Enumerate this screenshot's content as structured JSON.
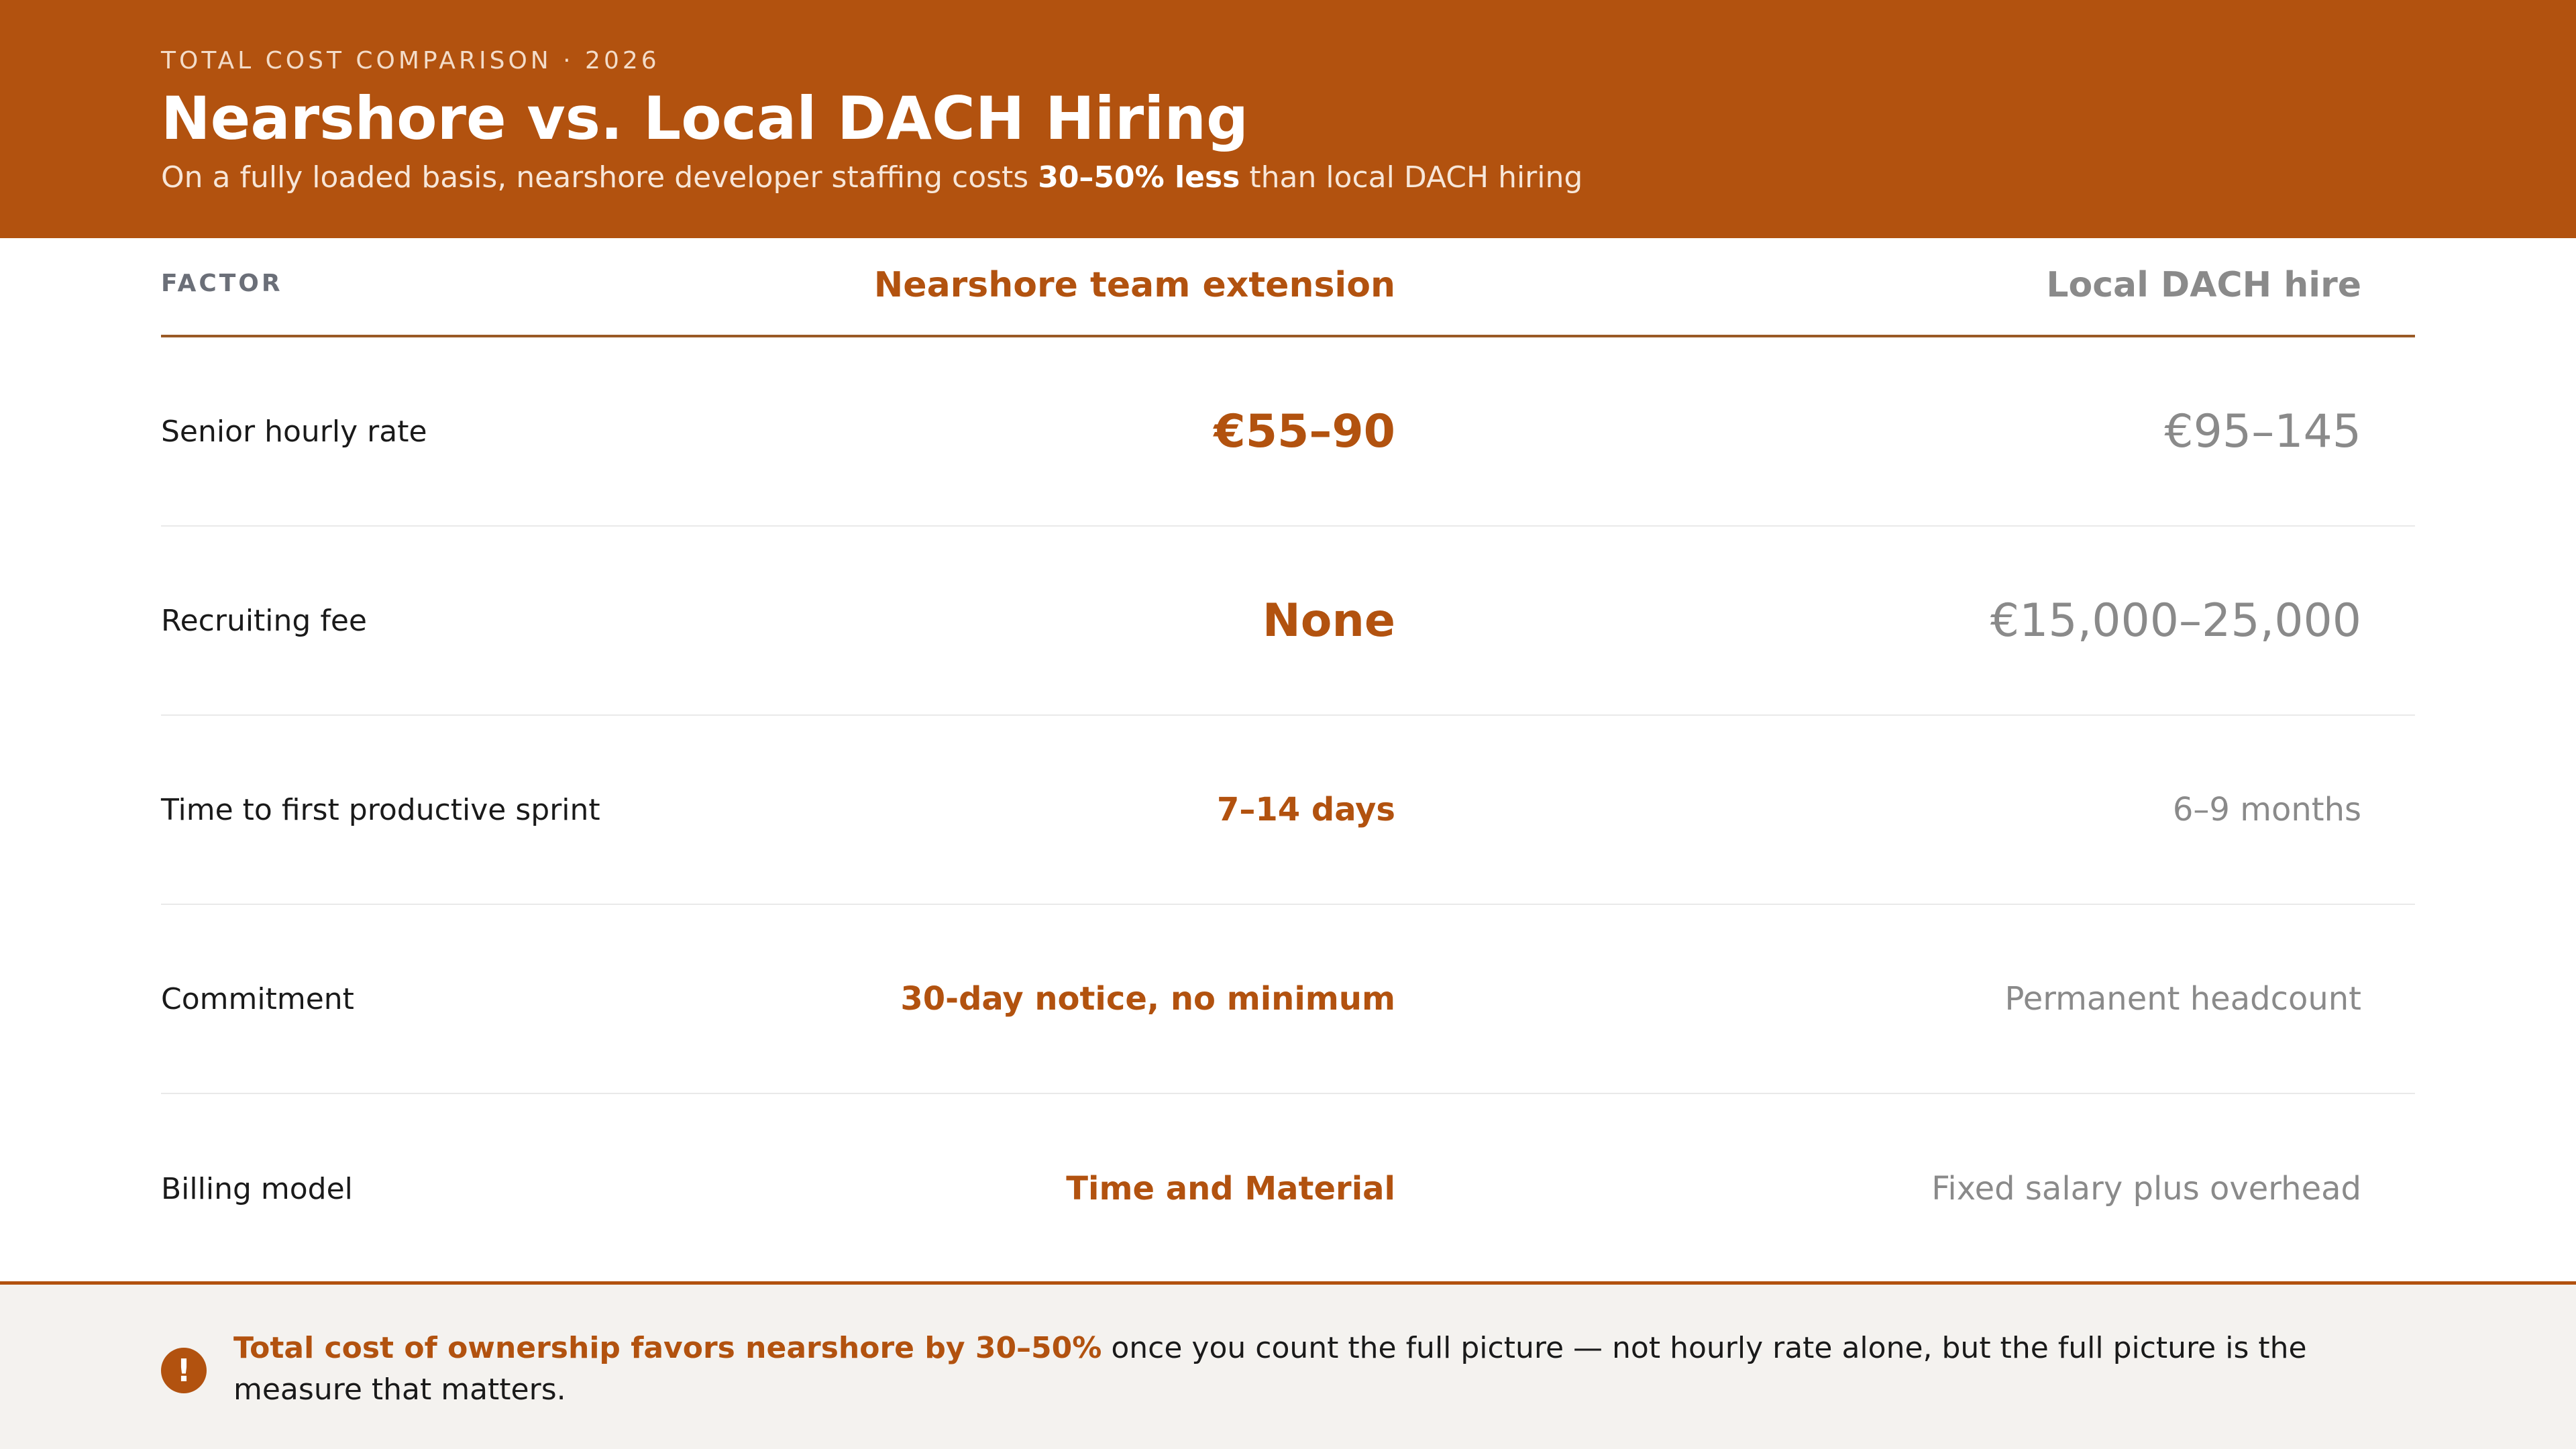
{
  "header": {
    "eyebrow": "TOTAL COST COMPARISON · 2026",
    "title": "Nearshore vs. Local DACH Hiring",
    "subtitle_pre": "On a fully loaded basis, nearshore developer staffing costs ",
    "subtitle_bold": "30–50% less",
    "subtitle_post": " than local DACH hiring"
  },
  "columns": {
    "factor": "FACTOR",
    "nearshore": "Nearshore team extension",
    "local": "Local DACH hire"
  },
  "rows": [
    {
      "factor": "Senior hourly rate",
      "nearshore": "€55–90",
      "local": "€95–145"
    },
    {
      "factor": "Recruiting fee",
      "nearshore": "None",
      "local": "€15,000–25,000"
    },
    {
      "factor": "Time to first productive sprint",
      "nearshore": "7–14 days",
      "local": "6–9 months"
    },
    {
      "factor": "Commitment",
      "nearshore": "30-day notice, no minimum",
      "local": "Permanent headcount"
    },
    {
      "factor": "Billing model",
      "nearshore": "Time and Material",
      "local": "Fixed salary plus overhead"
    }
  ],
  "footer": {
    "icon": "!",
    "highlight": "Total cost of ownership favors nearshore by 30–50%",
    "text": " once you count the full picture — not hourly rate alone, but the full picture is the measure that matters."
  },
  "colors": {
    "accent": "#b2520f",
    "muted": "#8a8a8a",
    "footer_bg": "#f4f2ef"
  }
}
